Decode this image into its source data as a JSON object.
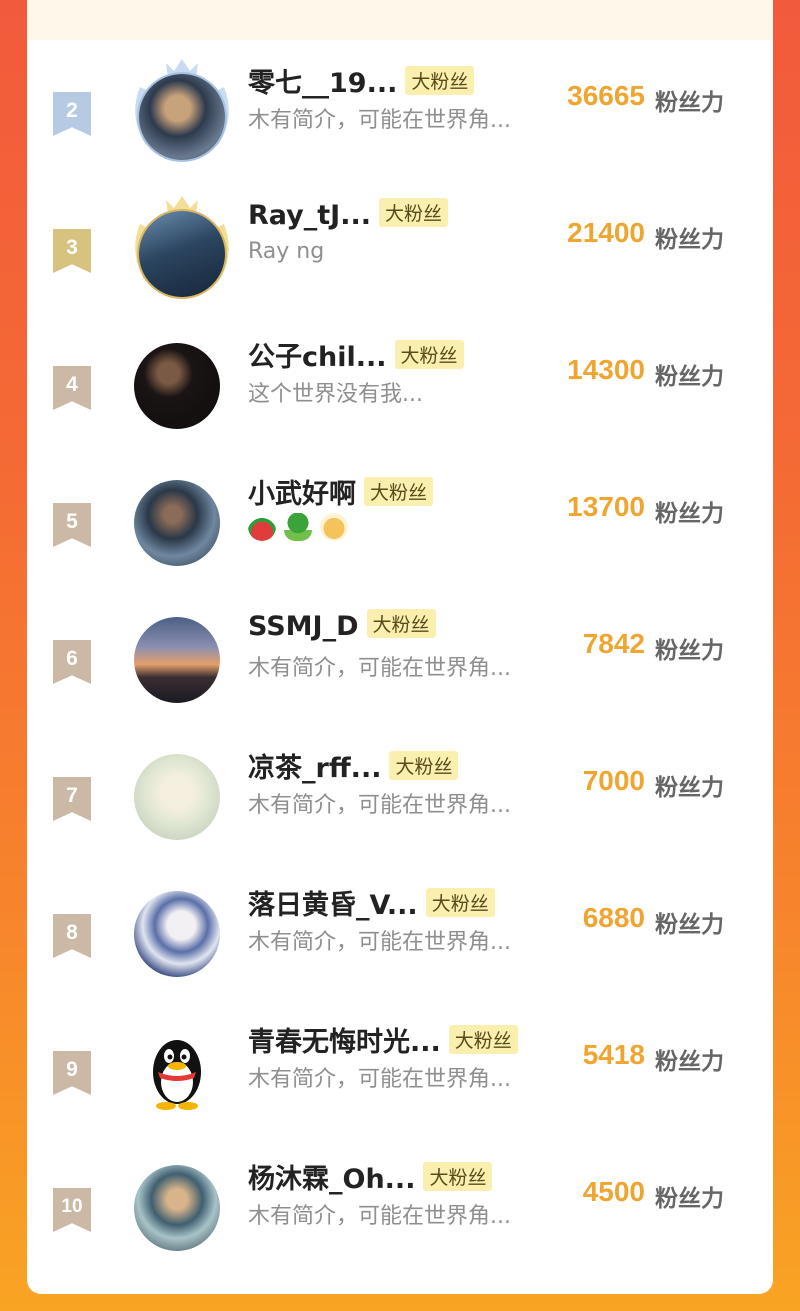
{
  "tag_label": "大粉丝",
  "unit_label": "粉丝力",
  "colors": {
    "rank_2": "#b6cbe3",
    "rank_3": "#d7c27f",
    "rank_other": "#cbb9a5",
    "score": "#f0a531",
    "tag_bg": "#fbefb0"
  },
  "rows": [
    {
      "rank": "2",
      "name": "零七__19...",
      "bio": "木有简介，可能在世界角...",
      "score": "36665"
    },
    {
      "rank": "3",
      "name": "Ray_tJ...",
      "bio": "Ray ng",
      "score": "21400"
    },
    {
      "rank": "4",
      "name": "公子chil...",
      "bio": "这个世界没有我...",
      "score": "14300"
    },
    {
      "rank": "5",
      "name": "小武好啊",
      "bio": "",
      "emojis": [
        "watermelon-icon",
        "broccoli-icon",
        "dumpling-icon"
      ],
      "score": "13700"
    },
    {
      "rank": "6",
      "name": "SSMJ_D",
      "bio": "木有简介，可能在世界角...",
      "score": "7842"
    },
    {
      "rank": "7",
      "name": "凉茶_rff...",
      "bio": "木有简介，可能在世界角...",
      "score": "7000"
    },
    {
      "rank": "8",
      "name": "落日黄昏_V...",
      "bio": "木有简介，可能在世界角...",
      "score": "6880"
    },
    {
      "rank": "9",
      "name": "青春无悔时光...",
      "bio": "木有简介，可能在世界角...",
      "score": "5418"
    },
    {
      "rank": "10",
      "name": "杨沐霖_Oh...",
      "bio": "木有简介，可能在世界角...",
      "score": "4500"
    }
  ]
}
